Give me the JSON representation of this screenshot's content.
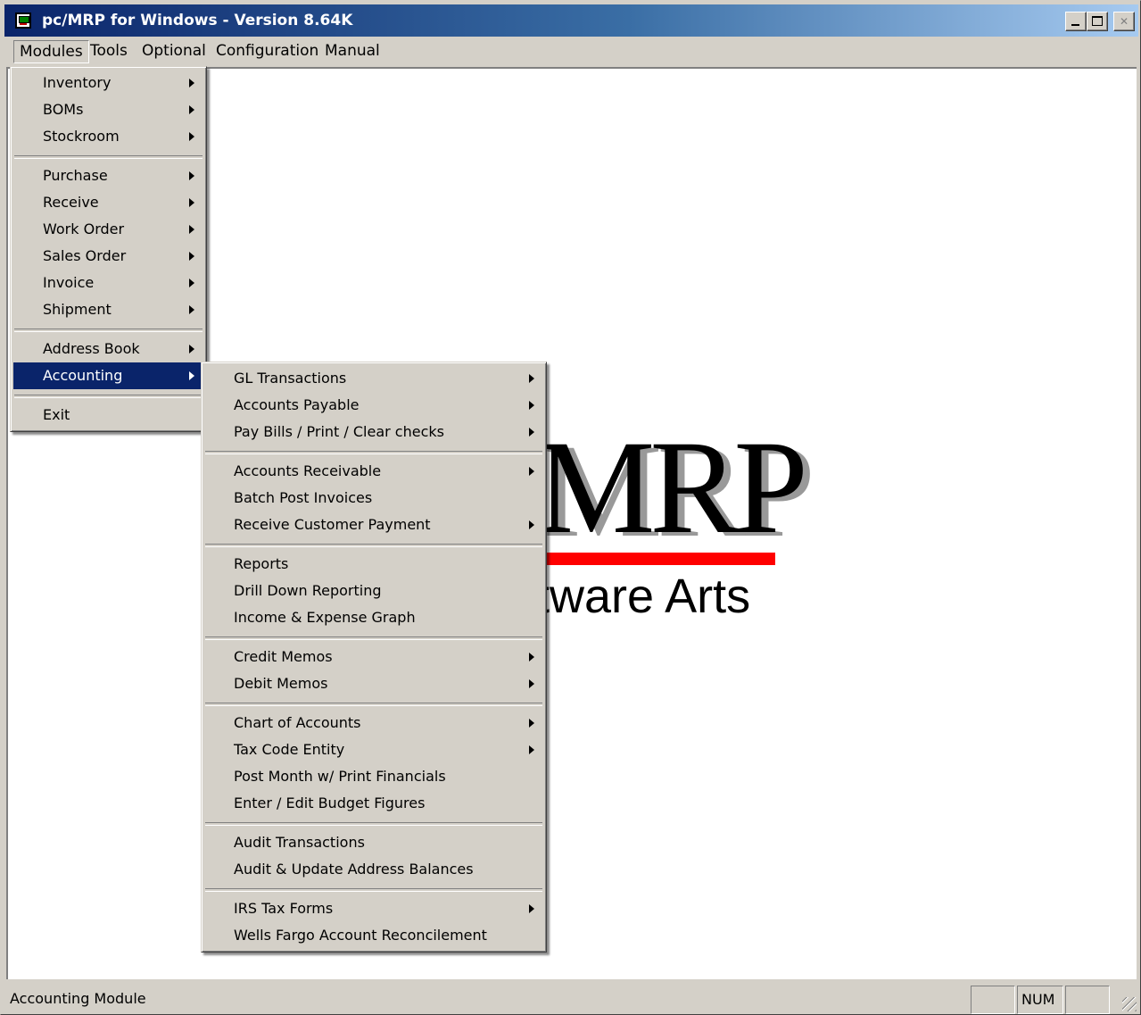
{
  "window": {
    "title": "pc/MRP for Windows - Version 8.64K",
    "controls": [
      "minimize-icon",
      "maximize-icon",
      "close-icon"
    ]
  },
  "menubar": {
    "items": [
      "Modules",
      "Tools",
      "Optional",
      "Configuration",
      "Manual"
    ]
  },
  "modules_menu": {
    "items": [
      {
        "label": "Inventory",
        "submenu": true
      },
      {
        "label": "BOMs",
        "submenu": true
      },
      {
        "label": "Stockroom",
        "submenu": true
      },
      {
        "label": "Purchase",
        "submenu": true
      },
      {
        "label": "Receive",
        "submenu": true
      },
      {
        "label": "Work Order",
        "submenu": true
      },
      {
        "label": "Sales Order",
        "submenu": true
      },
      {
        "label": "Invoice",
        "submenu": true
      },
      {
        "label": "Shipment",
        "submenu": true
      },
      {
        "label": "Address Book",
        "submenu": true
      },
      {
        "label": "Accounting",
        "submenu": true,
        "highlighted": true
      },
      {
        "label": "Exit",
        "submenu": false
      }
    ]
  },
  "accounting_menu": {
    "items": [
      {
        "label": "GL Transactions",
        "submenu": true
      },
      {
        "label": "Accounts Payable",
        "submenu": true
      },
      {
        "label": "Pay Bills / Print / Clear checks",
        "submenu": true
      },
      {
        "label": "Accounts Receivable",
        "submenu": true
      },
      {
        "label": "Batch Post Invoices",
        "submenu": false
      },
      {
        "label": "Receive Customer Payment",
        "submenu": true
      },
      {
        "label": "Reports",
        "submenu": false
      },
      {
        "label": "Drill Down Reporting",
        "submenu": false
      },
      {
        "label": "Income & Expense Graph",
        "submenu": false
      },
      {
        "label": "Credit Memos",
        "submenu": true
      },
      {
        "label": "Debit Memos",
        "submenu": true
      },
      {
        "label": "Chart of Accounts",
        "submenu": true
      },
      {
        "label": "Tax Code Entity",
        "submenu": true
      },
      {
        "label": "Post Month w/ Print Financials",
        "submenu": false
      },
      {
        "label": "Enter / Edit Budget Figures",
        "submenu": false
      },
      {
        "label": "Audit Transactions",
        "submenu": false
      },
      {
        "label": "Audit & Update Address Balances",
        "submenu": false
      },
      {
        "label": "IRS Tax Forms",
        "submenu": true
      },
      {
        "label": "Wells Fargo Account Reconcilement",
        "submenu": false
      }
    ]
  },
  "logo": {
    "wordmark": "MRP",
    "subtitle": "tware Arts",
    "accent_color": "#ff0000"
  },
  "statusbar": {
    "message": "Accounting Module",
    "indicators": [
      "",
      "NUM",
      ""
    ]
  },
  "colors": {
    "highlight": "#0a246a",
    "face": "#d4d0c8",
    "client_bg": "#ffffff"
  }
}
